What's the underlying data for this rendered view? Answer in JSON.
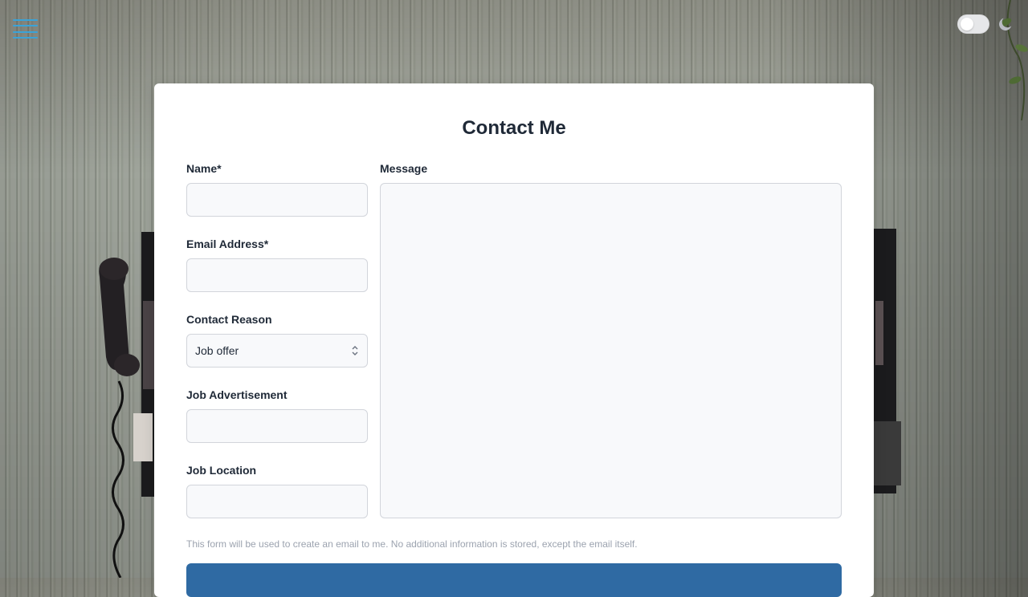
{
  "nav": {
    "menu_icon": "hamburger-menu-icon"
  },
  "theme": {
    "toggle_on": false,
    "mode_icon": "moon-icon"
  },
  "colors": {
    "accent": "#3aa3d8",
    "submit": "#2f6aa3",
    "card": "#ffffff"
  },
  "form": {
    "title": "Contact Me",
    "name": {
      "label": "Name*",
      "value": ""
    },
    "email": {
      "label": "Email Address*",
      "value": ""
    },
    "reason": {
      "label": "Contact Reason",
      "selected": "Job offer",
      "icon": "chevron-up-down-icon"
    },
    "job_ad": {
      "label": "Job Advertisement",
      "value": ""
    },
    "job_location": {
      "label": "Job Location",
      "value": ""
    },
    "message": {
      "label": "Message",
      "value": ""
    },
    "note": "This form will be used to create an email to me. No additional information is stored, except the email itself.",
    "submit_label": ""
  }
}
